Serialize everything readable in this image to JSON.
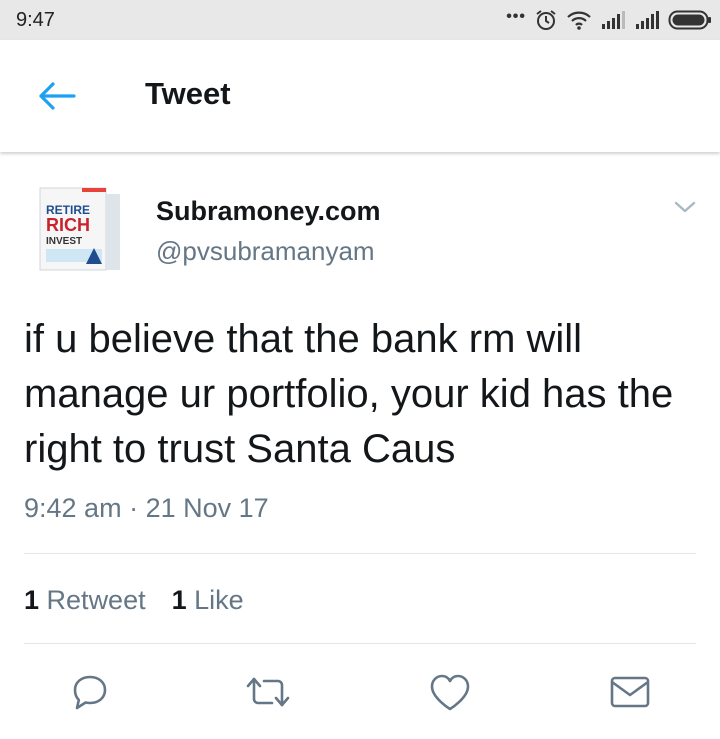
{
  "status_bar": {
    "time": "9:47",
    "icons": [
      "more-dots-icon",
      "alarm-icon",
      "wifi-icon",
      "signal-icon",
      "signal-icon",
      "battery-icon"
    ]
  },
  "header": {
    "title": "Tweet",
    "back_icon": "back-arrow-icon"
  },
  "tweet": {
    "author_name": "Subramoney.com",
    "author_handle": "@pvsubramanyam",
    "avatar_text": [
      "RETIRE",
      "RICH",
      "INVEST"
    ],
    "text": "if u believe that the bank rm will manage ur portfolio, your kid has the right to trust Santa Caus",
    "time": "9:42 am",
    "separator": "·",
    "date": "21 Nov 17",
    "retweets_count": "1",
    "retweets_label": "Retweet",
    "likes_count": "1",
    "likes_label": "Like"
  },
  "actions": [
    "reply-icon",
    "retweet-icon",
    "like-icon",
    "message-icon"
  ],
  "colors": {
    "accent": "#1da1f2",
    "secondary_text": "#657786",
    "primary_text": "#14171a",
    "status_bar_bg": "#e8e8e8"
  }
}
